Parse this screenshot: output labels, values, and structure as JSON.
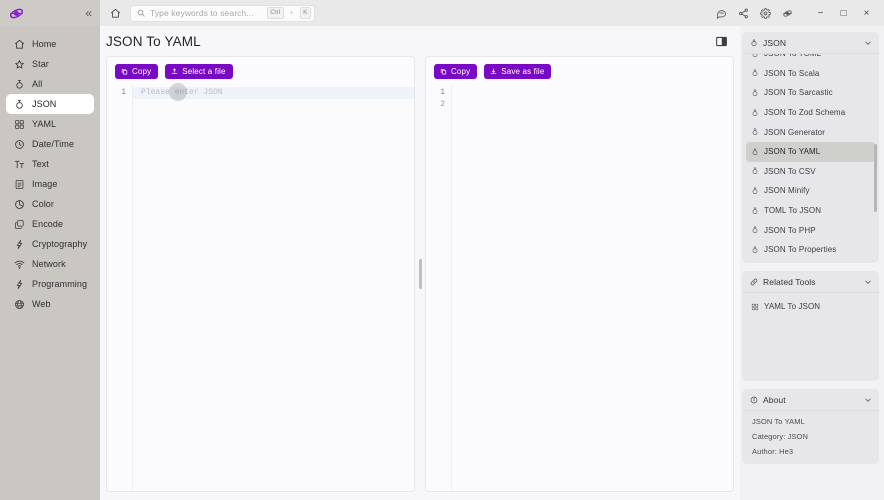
{
  "titlebar": {
    "logo_icon": "he3-logo-icon",
    "collapse_icon": "chevron-double-left-icon",
    "home_icon": "home-icon",
    "search": {
      "icon": "search-icon",
      "placeholder": "Type keywords to search...",
      "value": "",
      "shortcut_mod": "Ctrl",
      "shortcut_plus": "+",
      "shortcut_key": "K"
    },
    "icons": [
      {
        "name": "feedback-icon",
        "label": "Feedback"
      },
      {
        "name": "share-icon",
        "label": "Share"
      },
      {
        "name": "gear-icon",
        "label": "Settings"
      },
      {
        "name": "he3-logo-icon",
        "label": "He3"
      }
    ],
    "window_controls": {
      "minimize": "−",
      "maximize": "□",
      "close": "×"
    }
  },
  "sidebar": {
    "items": [
      {
        "label": "Home",
        "icon": "home-icon",
        "active": false
      },
      {
        "label": "Star",
        "icon": "star-icon",
        "active": false
      },
      {
        "label": "All",
        "icon": "all-icon",
        "active": false
      },
      {
        "label": "JSON",
        "icon": "json-icon",
        "active": true
      },
      {
        "label": "YAML",
        "icon": "yaml-icon",
        "active": false
      },
      {
        "label": "Date/Time",
        "icon": "clock-icon",
        "active": false
      },
      {
        "label": "Text",
        "icon": "text-icon",
        "active": false
      },
      {
        "label": "Image",
        "icon": "image-icon",
        "active": false
      },
      {
        "label": "Color",
        "icon": "color-icon",
        "active": false
      },
      {
        "label": "Encode",
        "icon": "encode-icon",
        "active": false
      },
      {
        "label": "Cryptography",
        "icon": "key-icon",
        "active": false
      },
      {
        "label": "Network",
        "icon": "wifi-icon",
        "active": false
      },
      {
        "label": "Programming",
        "icon": "code-icon",
        "active": false
      },
      {
        "label": "Web",
        "icon": "globe-icon",
        "active": false
      }
    ]
  },
  "page": {
    "title": "JSON To YAML",
    "panel_toggle_icon": "panel-toggle-icon"
  },
  "input_editor": {
    "copy_label": "Copy",
    "copy_icon": "copy-icon",
    "select_file_label": "Select a file",
    "select_file_icon": "upload-icon",
    "line_numbers": [
      "1"
    ],
    "placeholder": "Please enter JSON"
  },
  "output_editor": {
    "copy_label": "Copy",
    "copy_icon": "copy-icon",
    "save_label": "Save as file",
    "save_icon": "download-icon",
    "line_numbers": [
      "1",
      "2"
    ],
    "content": ""
  },
  "rail": {
    "category_card": {
      "title": "JSON",
      "icon": "json-icon",
      "chevron": "chevron-down-icon",
      "items": [
        {
          "label": "JSON To TOML",
          "icon": "json-icon",
          "active": false,
          "partial": true
        },
        {
          "label": "JSON To Scala",
          "icon": "json-icon",
          "active": false
        },
        {
          "label": "JSON To Sarcastic",
          "icon": "json-icon",
          "active": false
        },
        {
          "label": "JSON To Zod Schema",
          "icon": "json-icon",
          "active": false
        },
        {
          "label": "JSON Generator",
          "icon": "json-icon",
          "active": false
        },
        {
          "label": "JSON To YAML",
          "icon": "json-icon",
          "active": true
        },
        {
          "label": "JSON To CSV",
          "icon": "json-icon",
          "active": false
        },
        {
          "label": "JSON Minify",
          "icon": "json-icon",
          "active": false
        },
        {
          "label": "TOML To JSON",
          "icon": "json-icon",
          "active": false
        },
        {
          "label": "JSON To PHP",
          "icon": "json-icon",
          "active": false
        },
        {
          "label": "JSON To Properties",
          "icon": "json-icon",
          "active": false,
          "partial": true
        }
      ]
    },
    "related_card": {
      "title": "Related Tools",
      "icon": "link-icon",
      "chevron": "chevron-down-icon",
      "items": [
        {
          "label": "YAML To JSON",
          "icon": "yaml-icon"
        }
      ]
    },
    "about_card": {
      "title": "About",
      "icon": "info-icon",
      "chevron": "chevron-down-icon",
      "lines": [
        "JSON To YAML",
        "Category: JSON",
        "Author: He3"
      ]
    }
  },
  "colors": {
    "accent": "#7a09c4",
    "sidebar_bg": "#cac7c2",
    "titlebar_bg": "#cecbc6",
    "rail_bg": "#f2f2f4",
    "card_bg": "#e7e7ea",
    "active_tool_bg": "#cfcfcc",
    "editor_bg": "#fbfbfd",
    "highlight_line": "#eef3fa"
  }
}
